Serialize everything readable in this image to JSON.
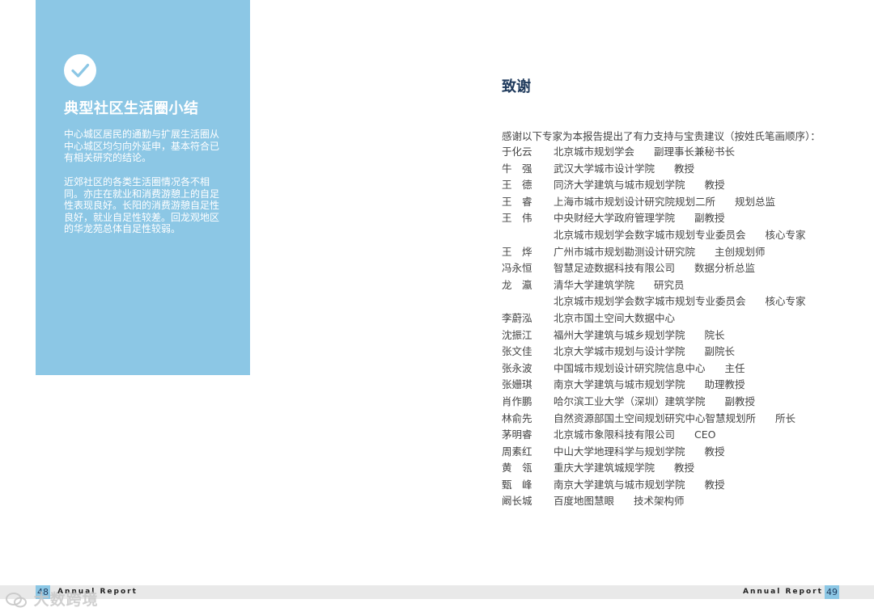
{
  "summary": {
    "title": "典型社区生活圈小结",
    "paragraph1": "中心城区居民的通勤与扩展生活圈从中心城区均匀向外延申，基本符合已有相关研究的结论。",
    "paragraph2": "近郊社区的各类生活圈情况各不相同。亦庄在就业和消费游憩上的自足性表现良好。长阳的消费游憩自足性良好，就业自足性较差。回龙观地区的华龙苑总体自足性较弱。",
    "accent_color": "#8cc7e5",
    "icon": "check-circle-icon"
  },
  "acknowledgement": {
    "title": "致谢",
    "intro": "感谢以下专家为本报告提出了有力支持与宝贵建议（按姓氏笔画顺序）：",
    "experts": [
      {
        "name": "于化云",
        "org": "北京城市规划学会",
        "role": "副理事长兼秘书长"
      },
      {
        "name": "牛　强",
        "org": "武汉大学城市设计学院",
        "role": "教授"
      },
      {
        "name": "王　德",
        "org": "同济大学建筑与城市规划学院",
        "role": "教授"
      },
      {
        "name": "王　睿",
        "org": "上海市城市规划设计研究院规划二所",
        "role": "规划总监"
      },
      {
        "name": "王　伟",
        "org": "中央财经大学政府管理学院",
        "role": "副教授"
      },
      {
        "name": "",
        "org": "北京城市规划学会数字城市规划专业委员会",
        "role": "核心专家"
      },
      {
        "name": "王　烨",
        "org": "广州市城市规划勘测设计研究院",
        "role": "主创规划师"
      },
      {
        "name": "冯永恒",
        "org": "智慧足迹数据科技有限公司",
        "role": "数据分析总监"
      },
      {
        "name": "龙　瀛",
        "org": "清华大学建筑学院",
        "role": "研究员"
      },
      {
        "name": "",
        "org": "北京城市规划学会数字城市规划专业委员会",
        "role": "核心专家"
      },
      {
        "name": "李蔚泓",
        "org": "北京市国土空间大数据中心",
        "role": ""
      },
      {
        "name": "沈振江",
        "org": "福州大学建筑与城乡规划学院",
        "role": "院长"
      },
      {
        "name": "张文佳",
        "org": "北京大学城市规划与设计学院",
        "role": "副院长"
      },
      {
        "name": "张永波",
        "org": "中国城市规划设计研究院信息中心",
        "role": "主任"
      },
      {
        "name": "张姗琪",
        "org": "南京大学建筑与城市规划学院",
        "role": "助理教授"
      },
      {
        "name": "肖作鹏",
        "org": "哈尔滨工业大学（深圳）建筑学院",
        "role": "副教授"
      },
      {
        "name": "林俞先",
        "org": "自然资源部国土空间规划研究中心智慧规划所",
        "role": "所长"
      },
      {
        "name": "茅明睿",
        "org": "北京城市象限科技有限公司",
        "role": "CEO"
      },
      {
        "name": "周素红",
        "org": "中山大学地理科学与规划学院",
        "role": "教授"
      },
      {
        "name": "黄　瓴",
        "org": "重庆大学建筑城规学院",
        "role": "教授"
      },
      {
        "name": "甄　峰",
        "org": "南京大学建筑与城市规划学院",
        "role": "教授"
      },
      {
        "name": "阚长城",
        "org": "百度地图慧眼",
        "role": "技术架构师"
      }
    ]
  },
  "footer": {
    "left_page": "48",
    "right_page": "49",
    "label": "Annual Report",
    "watermark": "大数跨境",
    "watermark_icon": "wechat-logo-icon"
  }
}
